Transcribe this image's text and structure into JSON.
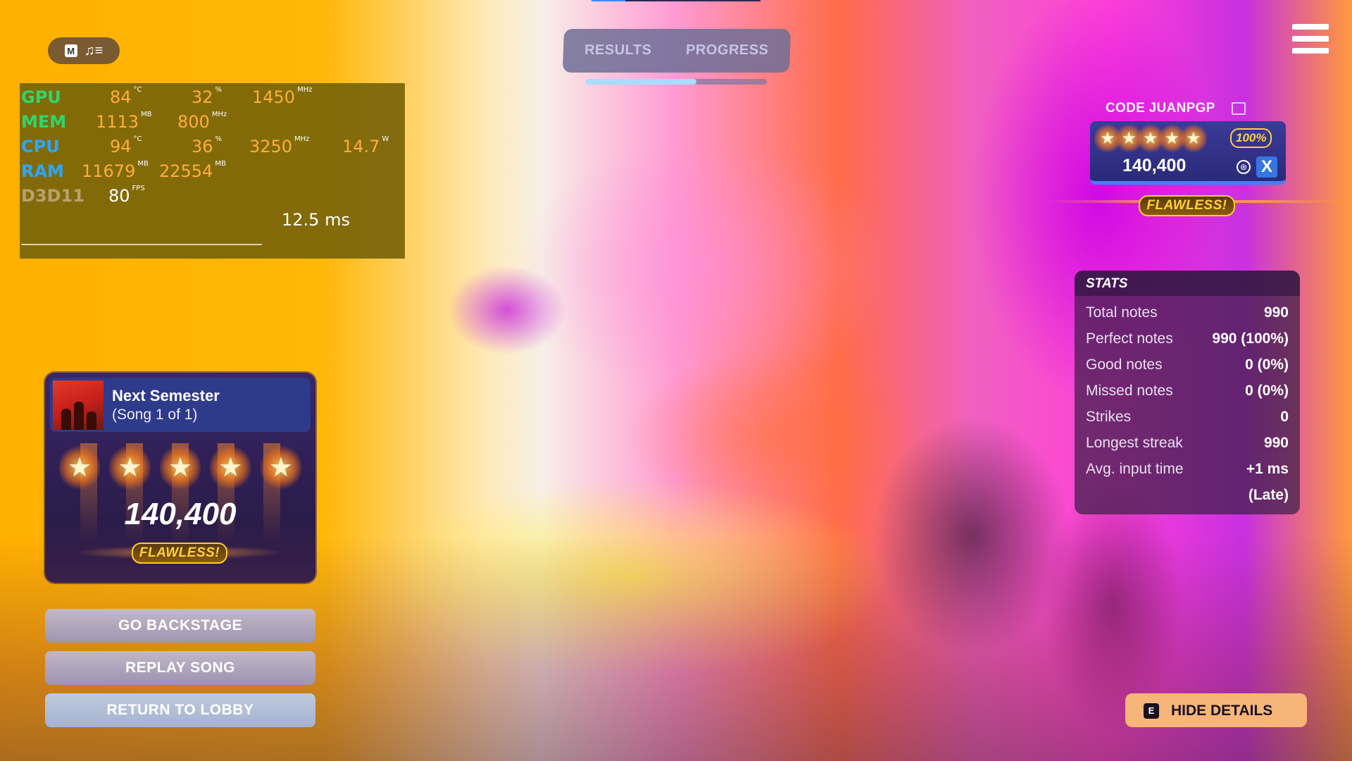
{
  "mode_pill": {
    "key": "M",
    "icon": "music-list-icon",
    "glyph": "♫≡"
  },
  "perf": {
    "rows": [
      {
        "label": "GPU",
        "values": [
          {
            "v": "84",
            "u": "°C"
          },
          {
            "v": "32",
            "u": "%"
          },
          {
            "v": "1450",
            "u": "MHz"
          }
        ]
      },
      {
        "label": "MEM",
        "values": [
          {
            "v": "1113",
            "u": "MB"
          },
          {
            "v": "800",
            "u": "MHz"
          }
        ]
      },
      {
        "label": "CPU",
        "values": [
          {
            "v": "94",
            "u": "°C"
          },
          {
            "v": "36",
            "u": "%"
          },
          {
            "v": "3250",
            "u": "MHz"
          },
          {
            "v": "14.7",
            "u": "W"
          }
        ]
      },
      {
        "label": "RAM",
        "values": [
          {
            "v": "11679",
            "u": "MB"
          },
          {
            "v": "22554",
            "u": "MB"
          }
        ]
      },
      {
        "label": "D3D11",
        "values": [
          {
            "v": "80",
            "u": "FPS"
          }
        ]
      }
    ],
    "frametime": "12.5 ms"
  },
  "tabs": {
    "results": "RESULTS",
    "progress": "PROGRESS",
    "progress_fraction": 0.61
  },
  "player": {
    "name": "CODE JUANPGP",
    "stars": 5,
    "star_glyph": "★",
    "percent": "100%",
    "score": "140,400",
    "platform_icon": "playstation-icon",
    "platform_glyph": "⊛",
    "close_label": "X",
    "badge": "FLAWLESS!"
  },
  "stats": {
    "title": "STATS",
    "rows": [
      {
        "label": "Total notes",
        "value": "990"
      },
      {
        "label": "Perfect notes",
        "value": "990 (100%)"
      },
      {
        "label": "Good notes",
        "value": "0 (0%)"
      },
      {
        "label": "Missed notes",
        "value": "0 (0%)"
      },
      {
        "label": "Strikes",
        "value": "0"
      },
      {
        "label": "Longest streak",
        "value": "990"
      },
      {
        "label": "Avg. input time",
        "value": "+1 ms"
      },
      {
        "label": "",
        "value": "(Late)"
      }
    ]
  },
  "song": {
    "title": "Next Semester",
    "subtitle": "(Song 1 of 1)",
    "stars": 5,
    "score": "140,400",
    "badge": "FLAWLESS!"
  },
  "buttons": {
    "go_backstage": "GO BACKSTAGE",
    "replay_song": "REPLAY SONG",
    "return_to_lobby": "RETURN TO LOBBY"
  },
  "hide_details": {
    "key": "E",
    "label": "HIDE DETAILS"
  },
  "colors": {
    "accent_badge": "#ffcc2a",
    "stars_glow": "#ff9a2a",
    "player_card": "#3b3b9a",
    "hide_button": "#f7b57a"
  }
}
